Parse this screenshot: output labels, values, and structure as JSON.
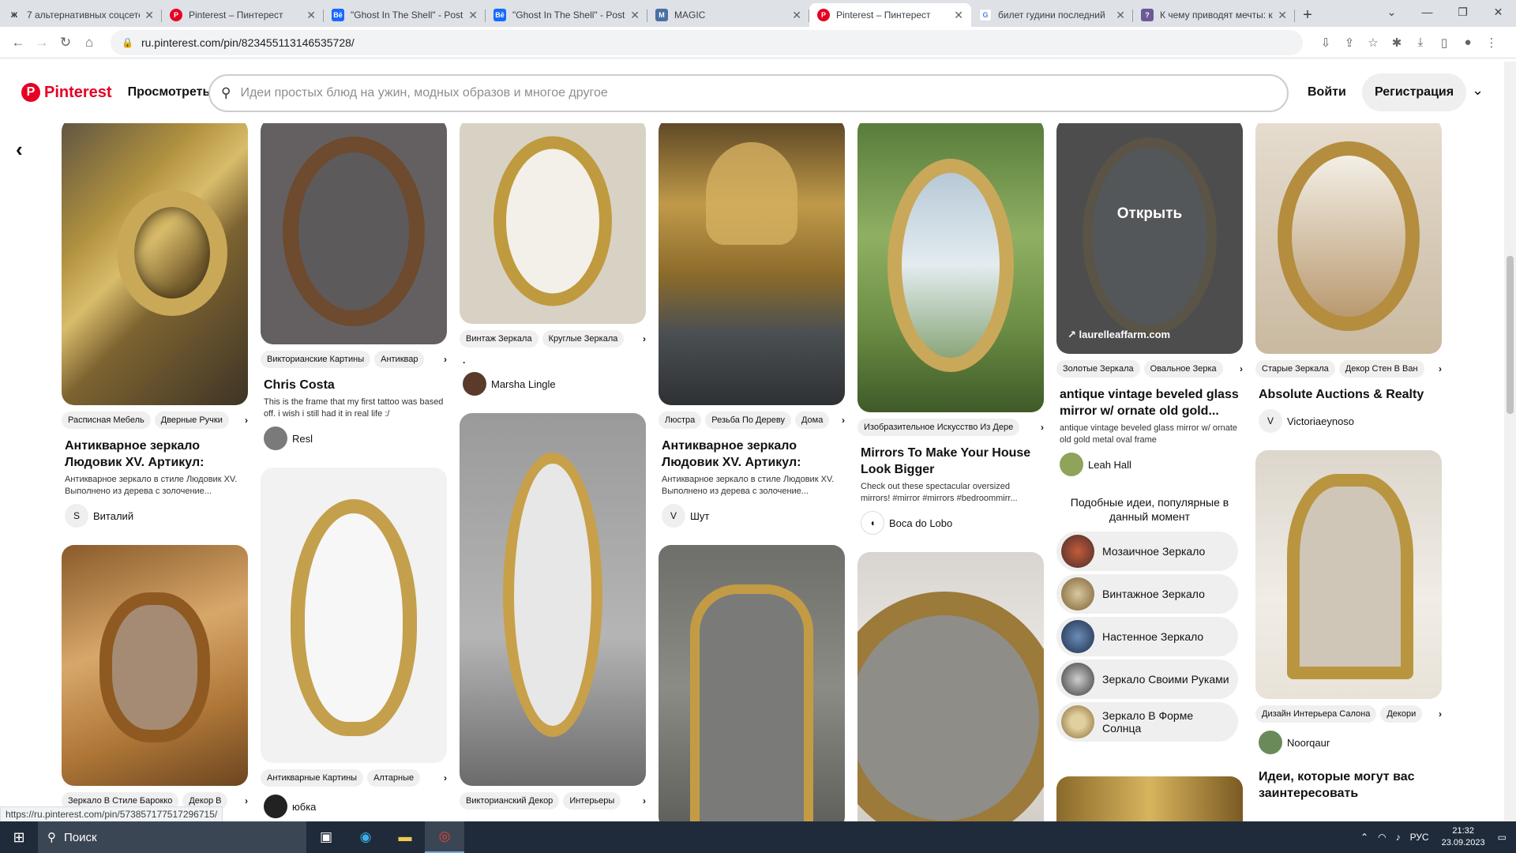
{
  "browser": {
    "tabs": [
      {
        "icon": "Ж",
        "icon_color": "#202124",
        "label": "7 альтернативных соцсете"
      },
      {
        "icon": "P",
        "icon_color": "#e60023",
        "label": "Pinterest – Пинтерест"
      },
      {
        "icon": "Bē",
        "icon_color": "#1769ff",
        "label": "\"Ghost In The Shell\" - Post"
      },
      {
        "icon": "Bē",
        "icon_color": "#1769ff",
        "label": "\"Ghost In The Shell\" - Post"
      },
      {
        "icon": "M",
        "icon_color": "#4a6fa5",
        "label": "MAGIC"
      },
      {
        "icon": "P",
        "icon_color": "#e60023",
        "label": "Pinterest – Пинтерест",
        "active": true
      },
      {
        "icon": "G",
        "icon_color": "#4285f4",
        "label": "билет гудини последний"
      },
      {
        "icon": "?",
        "icon_color": "#6b5b95",
        "label": "К чему приводят мечты: к"
      }
    ],
    "url": "ru.pinterest.com/pin/823455113146535728/",
    "status_url": "https://ru.pinterest.com/pin/573857177517296715/"
  },
  "header": {
    "logo": "Pinterest",
    "browse": "Просмотреть",
    "search_placeholder": "Идеи простых блюд на ужин, модных образов и многое другое",
    "login": "Войти",
    "signup": "Регистрация"
  },
  "pins": {
    "c1p1": {
      "tags": [
        "Расписная Мебель",
        "Дверные Ручки"
      ],
      "title": "Антикварное зеркало Людовик XV. Артикул: 14_28...",
      "desc": "Антикварное зеркало в стиле Людовик XV. Выполнено из дерева с золочение...",
      "user": "Виталий",
      "avatar": "S"
    },
    "c1p2": {
      "tags": [
        "Зеркало В Стиле Барокко",
        "Декор В"
      ]
    },
    "c2p1": {
      "tags": [
        "Викторианские Картины",
        "Антиквар"
      ],
      "title": "Chris Costa",
      "desc": "This is the frame that my first tattoo was based off. i wish i still had it in real life :/",
      "user": "Resl"
    },
    "c2p2": {
      "tags": [
        "Антикварные Картины",
        "Алтарные"
      ],
      "user": "юбка"
    },
    "c3p1": {
      "tags": [
        "Винтаж Зеркала",
        "Круглые Зеркала"
      ],
      "title": ".",
      "user": "Marsha Lingle"
    },
    "c3p2": {
      "tags": [
        "Викторианский Декор",
        "Интерьеры"
      ]
    },
    "c4p1": {
      "tags": [
        "Люстра",
        "Резьба По Дереву",
        "Дома"
      ],
      "title": "Антикварное зеркало Людовик XV. Артикул: 14_28...",
      "desc": "Антикварное зеркало в стиле Людовик XV. Выполнено из дерева с золочение...",
      "user": "Шут",
      "avatar": "V"
    },
    "c5p1": {
      "tags": [
        "Изобразительное Искусство Из Дере"
      ],
      "title": "Mirrors To Make Your House Look Bigger",
      "desc": "Check out these spectacular oversized mirrors! #mirror #mirrors #bedroommirr...",
      "user": "Boca do Lobo"
    },
    "c6p1": {
      "open": "Открыть",
      "source": "↗ laurelleaffarm.com",
      "tags": [
        "Золотые Зеркала",
        "Овальное Зерка"
      ],
      "title": "antique vintage beveled glass mirror w/ ornate old gold...",
      "desc": "antique vintage beveled glass mirror w/ ornate old gold metal oval frame",
      "user": "Leah Hall"
    },
    "c7p1": {
      "tags": [
        "Старые Зеркала",
        "Декор Стен В Ван"
      ],
      "title": "Absolute Auctions & Realty",
      "user": "Victoriaeynoso",
      "avatar": "V"
    },
    "c7p2": {
      "tags": [
        "Дизайн Интерьера Салона",
        "Декори"
      ],
      "user": "Noorqaur"
    }
  },
  "ideas": {
    "heading": "Подобные идеи, популярные в данный момент",
    "items": [
      "Мозаичное Зеркало",
      "Винтажное Зеркало",
      "Настенное Зеркало",
      "Зеркало Своими Руками",
      "Зеркало В Форме Солнца"
    ],
    "more": "Идеи, которые могут вас заинтересовать"
  },
  "taskbar": {
    "search": "Поиск",
    "lang": "РУС",
    "time": "21:32",
    "date": "23.09.2023"
  }
}
